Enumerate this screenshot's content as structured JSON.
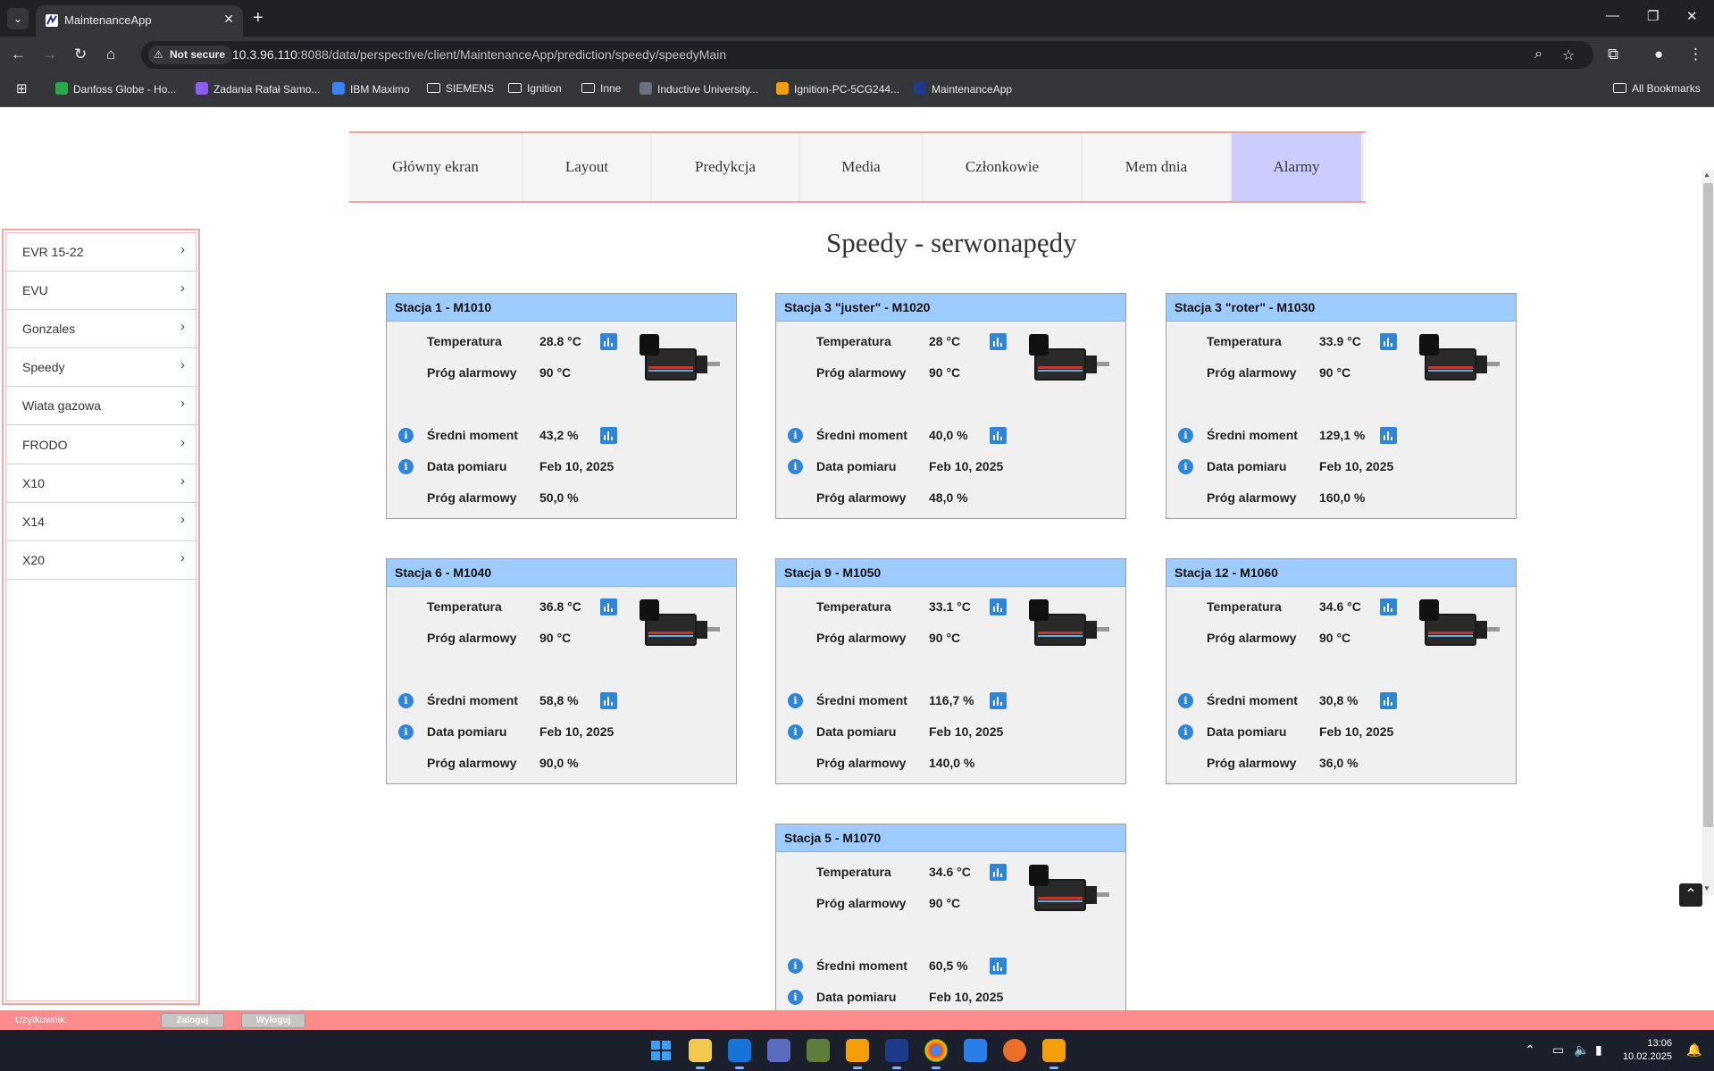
{
  "browser": {
    "tab_title": "MaintenanceApp",
    "security_label": "Not secure",
    "url_host": "10.3.96.110",
    "url_path": ":8088/data/perspective/client/MaintenanceApp/prediction/speedy/speedyMain",
    "bookmarks": [
      {
        "label": "Danfoss Globe - Ho...",
        "icon": "danfoss-icon",
        "color": "#2aa84a"
      },
      {
        "label": "Zadania Rafał Samo...",
        "icon": "tasks-icon",
        "color": "#8b5cf6"
      },
      {
        "label": "IBM Maximo",
        "icon": "ibm-maximo-icon",
        "color": "#3b82f6"
      },
      {
        "label": "SIEMENS",
        "icon": "folder-icon",
        "color": ""
      },
      {
        "label": "Ignition",
        "icon": "folder-icon",
        "color": ""
      },
      {
        "label": "Inne",
        "icon": "folder-icon",
        "color": ""
      },
      {
        "label": "Inductive University...",
        "icon": "inductive-icon",
        "color": "#6b7280"
      },
      {
        "label": "Ignition-PC-5CG244...",
        "icon": "ignition-icon",
        "color": "#f59e0b"
      },
      {
        "label": "MaintenanceApp",
        "icon": "maintenance-app-icon",
        "color": "#1e3a8a"
      }
    ],
    "all_bookmarks": "All Bookmarks"
  },
  "topnav": [
    {
      "label": "Główny ekran",
      "active": false
    },
    {
      "label": "Layout",
      "active": false
    },
    {
      "label": "Predykcja",
      "active": false
    },
    {
      "label": "Media",
      "active": false
    },
    {
      "label": "Członkowie",
      "active": false
    },
    {
      "label": "Mem dnia",
      "active": false
    },
    {
      "label": "Alarmy",
      "active": true
    }
  ],
  "sidebar": {
    "items": [
      {
        "label": "EVR 15-22"
      },
      {
        "label": "EVU"
      },
      {
        "label": "Gonzales"
      },
      {
        "label": "Speedy"
      },
      {
        "label": "Wiata gazowa"
      },
      {
        "label": "FRODO"
      },
      {
        "label": "X10"
      },
      {
        "label": "X14"
      },
      {
        "label": "X20"
      }
    ]
  },
  "page": {
    "title": "Speedy - serwonapędy"
  },
  "labels": {
    "temperature": "Temperatura",
    "alarm_threshold": "Próg alarmowy",
    "avg_torque": "Średni moment",
    "measure_date": "Data pomiaru"
  },
  "cards": [
    {
      "title": "Stacja 1 - M1010",
      "temperature": "28.8 °C",
      "temp_threshold": "90 °C",
      "avg_torque": "43,2 %",
      "date": "Feb 10, 2025",
      "torque_threshold": "50,0 %"
    },
    {
      "title": "Stacja 3 \"juster\" - M1020",
      "temperature": "28 °C",
      "temp_threshold": "90 °C",
      "avg_torque": "40,0 %",
      "date": "Feb 10, 2025",
      "torque_threshold": "48,0 %"
    },
    {
      "title": "Stacja 3 \"roter\" - M1030",
      "temperature": "33.9 °C",
      "temp_threshold": "90 °C",
      "avg_torque": "129,1 %",
      "date": "Feb 10, 2025",
      "torque_threshold": "160,0 %"
    },
    {
      "title": "Stacja 6 - M1040",
      "temperature": "36.8 °C",
      "temp_threshold": "90 °C",
      "avg_torque": "58,8 %",
      "date": "Feb 10, 2025",
      "torque_threshold": "90,0 %"
    },
    {
      "title": "Stacja 9 - M1050",
      "temperature": "33.1 °C",
      "temp_threshold": "90 °C",
      "avg_torque": "116,7 %",
      "date": "Feb 10, 2025",
      "torque_threshold": "140,0 %"
    },
    {
      "title": "Stacja 12 - M1060",
      "temperature": "34.6 °C",
      "temp_threshold": "90 °C",
      "avg_torque": "30,8 %",
      "date": "Feb 10, 2025",
      "torque_threshold": "36,0 %"
    },
    {
      "title": "Stacja 5 - M1070",
      "temperature": "34.6 °C",
      "temp_threshold": "90 °C",
      "avg_torque": "60,5 %",
      "date": "Feb 10, 2025",
      "torque_threshold": ""
    }
  ],
  "footer": {
    "user_label": "Użytkownik:",
    "login_label": "Zaloguj",
    "logout_label": "Wyloguj"
  },
  "taskbar": {
    "time": "13:06",
    "date": "10.02.2025"
  },
  "colors": {
    "card_header": "#9fccff",
    "active_nav": "#ccccff",
    "accent_border": "#f4a0a0",
    "footer": "#ff8c8c",
    "icon_blue": "#2f86d6"
  }
}
